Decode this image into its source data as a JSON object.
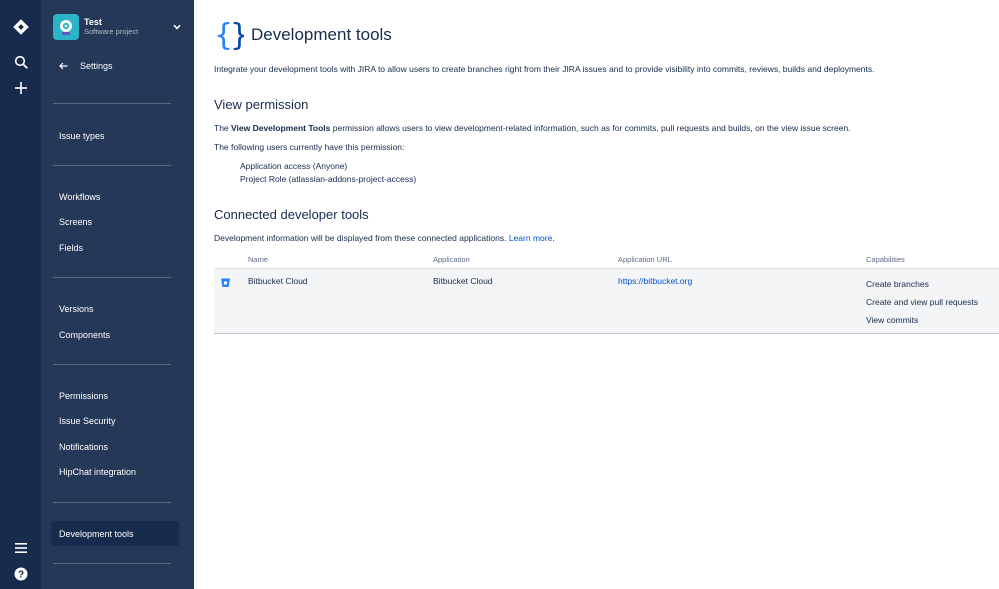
{
  "global_nav": {
    "icons": [
      "jira-logo-icon",
      "search-icon",
      "create-plus-icon",
      "menu-icon",
      "help-icon"
    ]
  },
  "project": {
    "name": "Test",
    "type": "Software project"
  },
  "sidebar": {
    "back_label": "Settings",
    "items": [
      {
        "label": "Issue types"
      },
      {
        "label": "Workflows"
      },
      {
        "label": "Screens"
      },
      {
        "label": "Fields"
      },
      {
        "label": "Versions"
      },
      {
        "label": "Components"
      },
      {
        "label": "Permissions"
      },
      {
        "label": "Issue Security"
      },
      {
        "label": "Notifications"
      },
      {
        "label": "HipChat integration"
      },
      {
        "label": "Development tools"
      }
    ],
    "active_item": "Development tools"
  },
  "main": {
    "title": "Development tools",
    "intro": "Integrate your development tools with JIRA to allow users to create branches right from their JIRA issues and to provide visibility into commits, reviews, builds and deployments.",
    "view_permission": {
      "heading": "View permission",
      "text_prefix": "The ",
      "text_bold": "View Development Tools",
      "text_suffix": " permission allows users to view development-related information, such as for commits, pull requests and builds, on the view issue screen.",
      "users_intro": "The following users currently have this permission:",
      "users": [
        "Application access (Anyone)",
        "Project Role (atlassian-addons-project-access)"
      ]
    },
    "connected": {
      "heading": "Connected developer tools",
      "text": "Development information will be displayed from these connected applications.",
      "learn_more": "Learn more",
      "text_end": ".",
      "columns": {
        "name": "Name",
        "application": "Application",
        "url": "Application URL",
        "capabilities": "Capabilities"
      },
      "rows": [
        {
          "icon": "bitbucket-icon",
          "name": "Bitbucket Cloud",
          "application": "Bitbucket Cloud",
          "url": "https://bitbucket.org",
          "capabilities": [
            "Create branches",
            "Create and view pull requests",
            "View commits"
          ]
        }
      ]
    }
  },
  "colors": {
    "rail": "#172b4d",
    "sidebar": "#253858",
    "link": "#0052cc",
    "text": "#172b4d"
  }
}
